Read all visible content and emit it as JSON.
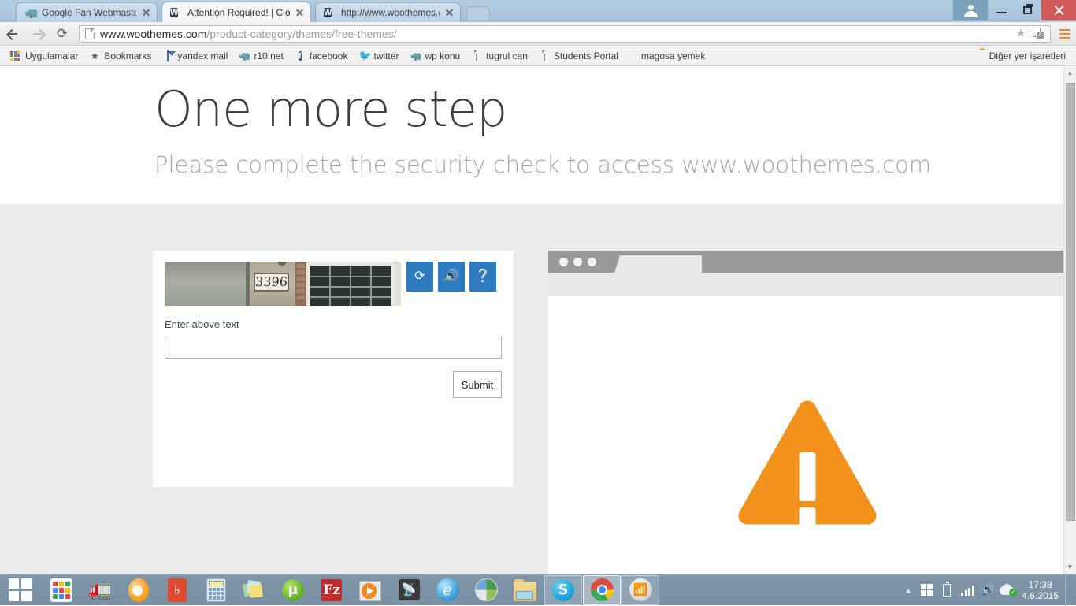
{
  "browser": {
    "tabs": [
      {
        "title": "Google Fan Webmaster Fo",
        "favicon": "bunny-icon",
        "active": false
      },
      {
        "title": "Attention Required! | Clou",
        "favicon": "woothemes-w-icon",
        "active": true
      },
      {
        "title": "http://www.woothemes.co",
        "favicon": "woothemes-w-icon",
        "active": false
      }
    ],
    "new_tab_label": "",
    "window_controls": {
      "avatar": "user-avatar-icon",
      "minimize": "minimize-icon",
      "maximize": "restore-icon",
      "close": "close-icon"
    },
    "toolbar": {
      "back": "back-arrow-icon",
      "forward": "forward-arrow-icon",
      "reload": "reload-icon",
      "url_domain": "www.woothemes.com",
      "url_path": "/product-category/themes/free-themes/",
      "star": "bookmark-star-icon",
      "translate": "translate-icon",
      "menu": "chrome-menu-icon"
    },
    "bookmarks": [
      {
        "label": "Uygulamalar",
        "icon": "apps-grid-icon"
      },
      {
        "label": "Bookmarks",
        "icon": "star-icon"
      },
      {
        "label": "yandex mail",
        "icon": "mail-icon"
      },
      {
        "label": "r10.net",
        "icon": "bunny-icon"
      },
      {
        "label": "facebook",
        "icon": "facebook-icon"
      },
      {
        "label": "twitter",
        "icon": "twitter-icon"
      },
      {
        "label": "wp konu",
        "icon": "bunny-icon"
      },
      {
        "label": "tugrul can",
        "icon": "page-icon"
      },
      {
        "label": "Students Portal",
        "icon": "page-icon"
      },
      {
        "label": "magosa yemek",
        "icon": "none"
      }
    ],
    "other_bookmarks": {
      "label": "Diğer yer işaretleri",
      "icon": "folder-icon"
    }
  },
  "page": {
    "heading": "One more step",
    "subheading": "Please complete the security check to access www.woothemes.com",
    "captcha": {
      "image_alt": "house-number-photo",
      "image_number": "3396",
      "refresh_icon": "refresh-icon",
      "audio_icon": "speaker-icon",
      "help_icon": "help-icon",
      "input_label": "Enter above text",
      "input_value": "",
      "input_placeholder": "",
      "submit_label": "Submit"
    },
    "illustration": {
      "name": "browser-window-warning-illustration",
      "warning_icon": "warning-triangle-icon",
      "accent_color": "#f2921d",
      "titlebar_color": "#999999",
      "toolbar_color": "#e8e8e8"
    },
    "scrollbar": {
      "up": "scroll-up-arrow",
      "down": "scroll-down-arrow"
    }
  },
  "taskbar": {
    "start": "windows-start-icon",
    "items": [
      {
        "name": "apps-launcher",
        "icon": "apps-grid-icon",
        "state": "pinned"
      },
      {
        "name": "euro-truck-simulator",
        "icon": "truck-icon",
        "state": "pinned"
      },
      {
        "name": "gom-player",
        "icon": "egg-icon",
        "state": "pinned"
      },
      {
        "name": "notepad-app",
        "icon": "red-box-icon",
        "state": "pinned"
      },
      {
        "name": "calculator",
        "icon": "calculator-icon",
        "state": "pinned"
      },
      {
        "name": "sticky-notes",
        "icon": "notes-icon",
        "state": "pinned"
      },
      {
        "name": "utorrent",
        "icon": "utorrent-icon",
        "state": "pinned"
      },
      {
        "name": "filezilla",
        "icon": "filezilla-icon",
        "state": "pinned"
      },
      {
        "name": "media-player",
        "icon": "player-icon",
        "state": "pinned"
      },
      {
        "name": "rss-reader",
        "icon": "rss-icon",
        "state": "pinned"
      },
      {
        "name": "internet-explorer",
        "icon": "ie-icon",
        "state": "pinned"
      },
      {
        "name": "maxthon-browser",
        "icon": "globe-icon",
        "state": "pinned"
      },
      {
        "name": "file-explorer",
        "icon": "folder-icon",
        "state": "pinned"
      },
      {
        "name": "skype",
        "icon": "skype-icon",
        "state": "open"
      },
      {
        "name": "google-chrome",
        "icon": "chrome-icon",
        "state": "active"
      },
      {
        "name": "wifi-manager",
        "icon": "wifi-hand-icon",
        "state": "open"
      }
    ],
    "tray": {
      "overflow": "show-hidden-icons-arrow",
      "icons": [
        "windows-flag-icon",
        "battery-icon",
        "signal-bars-icon",
        "volume-icon",
        "cloud-sync-icon"
      ],
      "time": "17:38",
      "date": "4.6.2015"
    }
  }
}
